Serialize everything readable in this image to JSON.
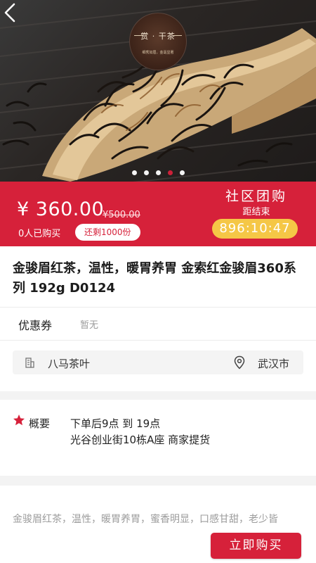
{
  "hero": {
    "brand_title": "赏 · 干茶",
    "brand_subtitle": "细秀如眉，金毫显著",
    "slide_count": 5,
    "active_slide": 4
  },
  "price_bar": {
    "current_price": "¥ 360.00",
    "original_price": "¥500.00",
    "sold_text": "0人已购买",
    "remaining_text": "还剩1000份",
    "group_buy_title": "社区团购",
    "countdown_label": "距结束",
    "countdown": "896:10:47",
    "accent_color": "#d6213a",
    "countdown_color": "#f5c746"
  },
  "product": {
    "title": "金骏眉红茶，温性，暖胃养胃 金索红金骏眉360系列 192g D0124"
  },
  "coupon": {
    "label": "优惠券",
    "value": "暂无"
  },
  "store": {
    "icon": "building-icon",
    "name": "八马茶叶",
    "location_icon": "map-pin-icon",
    "city": "武汉市"
  },
  "summary": {
    "icon": "star-icon",
    "label": "概要",
    "line1": "下单后9点 到 19点",
    "line2": "光谷创业街10栋A座 商家提货"
  },
  "description": {
    "text": "金骏眉红茶，温性，暖胃养胃，蜜香明显，口感甘甜，老少皆"
  },
  "actions": {
    "buy_label": "立即购买"
  }
}
